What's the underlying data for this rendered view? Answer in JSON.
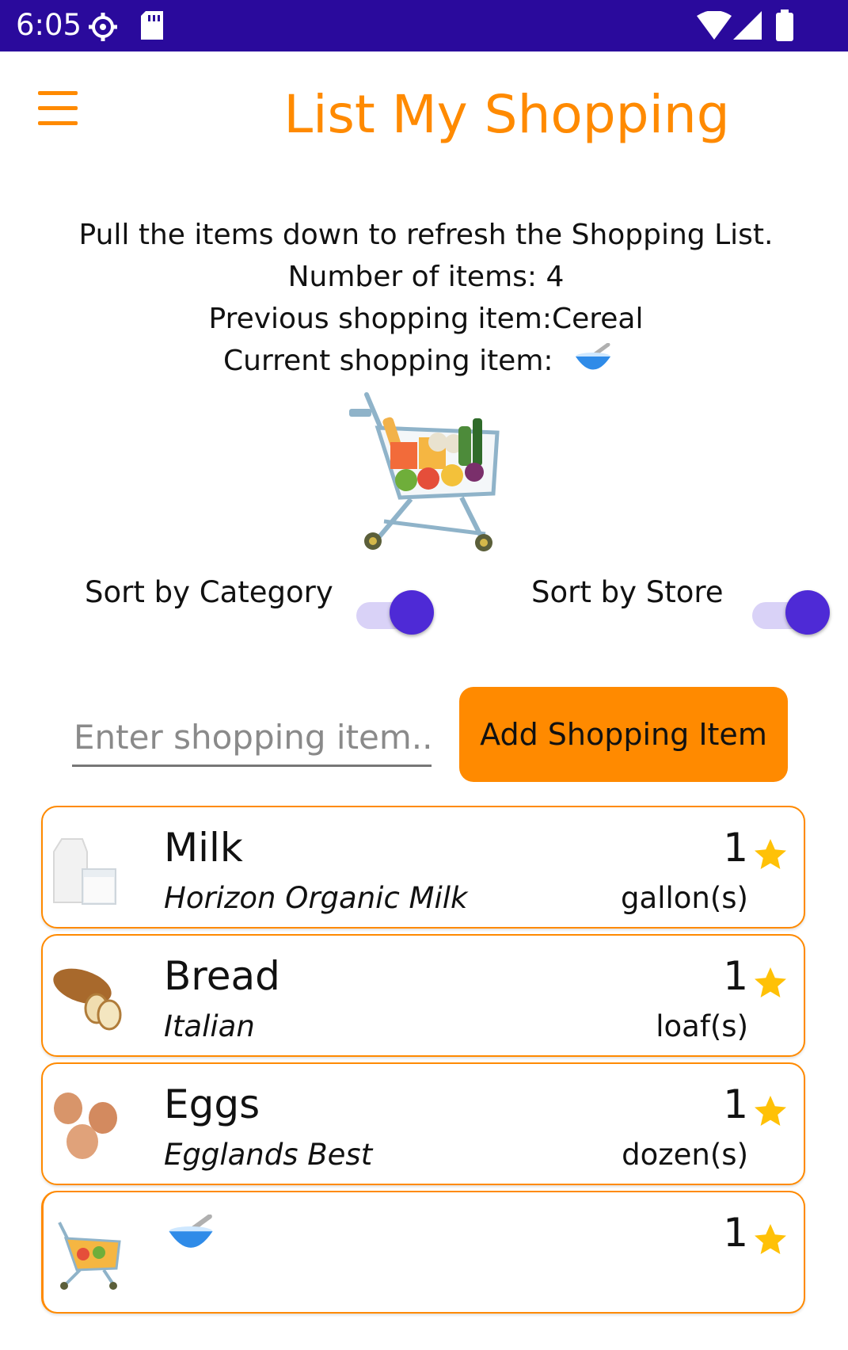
{
  "status_bar": {
    "time": "6:05"
  },
  "app_bar": {
    "title": "List My Shopping",
    "menu_icon": "hamburger-menu-icon"
  },
  "info": {
    "refresh_hint": "Pull the items down to refresh the Shopping List.",
    "item_count": "Number of items: 4",
    "previous_item": "Previous shopping item:Cereal",
    "current_item_label": "Current shopping item:"
  },
  "sort": {
    "category_label": "Sort by Category",
    "category_on": true,
    "store_label": "Sort by Store",
    "store_on": true
  },
  "add_form": {
    "placeholder": "Enter shopping item..",
    "value": "",
    "button_label": "Add Shopping Item"
  },
  "items": [
    {
      "name": "Milk",
      "brand": "Horizon Organic Milk",
      "quantity": "1",
      "unit": "gallon(s)",
      "image": "milk-image",
      "starred": true
    },
    {
      "name": "Bread",
      "brand": "Italian",
      "quantity": "1",
      "unit": "loaf(s)",
      "image": "bread-image",
      "starred": true
    },
    {
      "name": "Eggs",
      "brand": "Egglands Best",
      "quantity": "1",
      "unit": "dozen(s)",
      "image": "eggs-image",
      "starred": true
    },
    {
      "name": "",
      "brand": "",
      "quantity": "1",
      "unit": "",
      "image": "shopping-cart-image",
      "starred": true
    }
  ],
  "colors": {
    "accent": "#ff8a00",
    "status_bar": "#2a0a9c",
    "toggle": "#4e2ad6",
    "star": "#ffc107"
  }
}
